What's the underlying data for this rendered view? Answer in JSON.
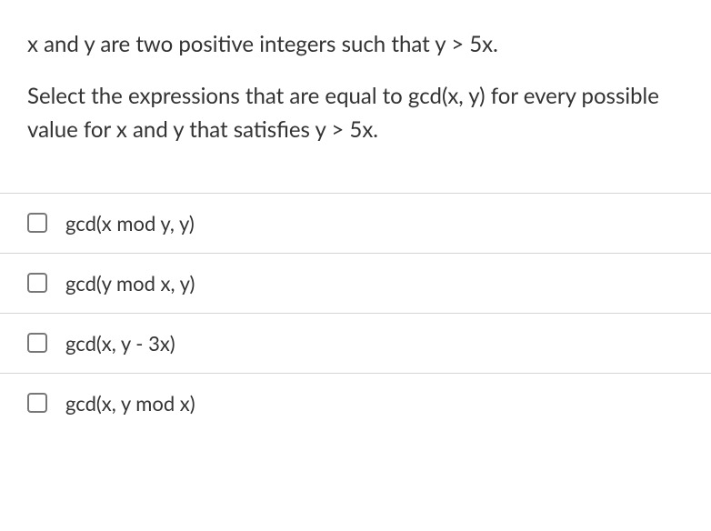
{
  "question": {
    "line1": "x and y are two positive integers such that y > 5x.",
    "line2": "Select the expressions that are equal to gcd(x, y) for every possible value for x and y that satisfies y > 5x."
  },
  "options": [
    {
      "label": "gcd(x mod y, y)"
    },
    {
      "label": "gcd(y mod x, y)"
    },
    {
      "label": "gcd(x, y - 3x)"
    },
    {
      "label": "gcd(x, y mod x)"
    }
  ]
}
